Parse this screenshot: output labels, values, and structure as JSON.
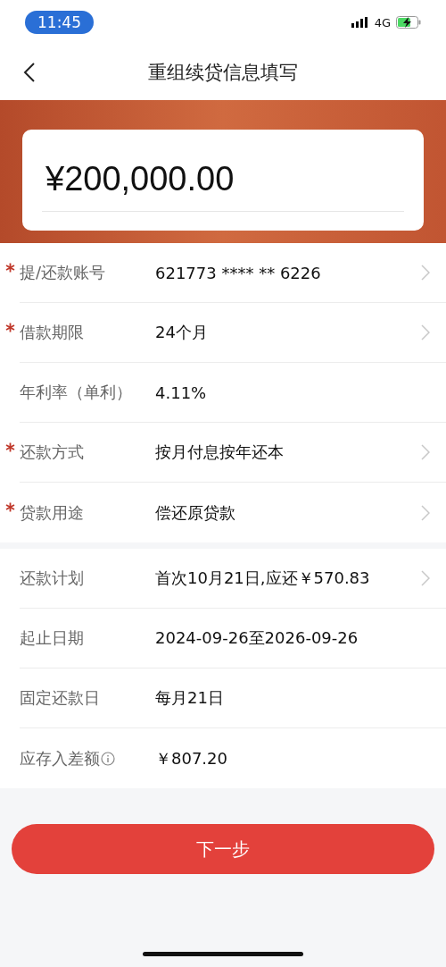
{
  "status_bar": {
    "time": "11:45",
    "network": "4G"
  },
  "nav": {
    "title": "重组续贷信息填写"
  },
  "amount": "¥200,000.00",
  "sections": [
    {
      "rows": [
        {
          "label": "提/还款账号",
          "value": "621773 **** ** 6226",
          "required": true,
          "chevron": true,
          "info": false
        },
        {
          "label": "借款期限",
          "value": "24个月",
          "required": true,
          "chevron": true,
          "info": false
        },
        {
          "label": "年利率（单利）",
          "value": "4.11%",
          "required": false,
          "chevron": false,
          "info": false
        },
        {
          "label": "还款方式",
          "value": "按月付息按年还本",
          "required": true,
          "chevron": true,
          "info": false
        },
        {
          "label": "贷款用途",
          "value": "偿还原贷款",
          "required": true,
          "chevron": true,
          "info": false
        }
      ]
    },
    {
      "rows": [
        {
          "label": "还款计划",
          "value": "首次10月21日,应还￥570.83",
          "required": false,
          "chevron": true,
          "info": false
        },
        {
          "label": "起止日期",
          "value": "2024-09-26至2026-09-26",
          "required": false,
          "chevron": false,
          "info": false
        },
        {
          "label": "固定还款日",
          "value": "每月21日",
          "required": false,
          "chevron": false,
          "info": false
        },
        {
          "label": "应存入差额",
          "value": "￥807.20",
          "required": false,
          "chevron": false,
          "info": true
        }
      ]
    }
  ],
  "next_button": "下一步"
}
